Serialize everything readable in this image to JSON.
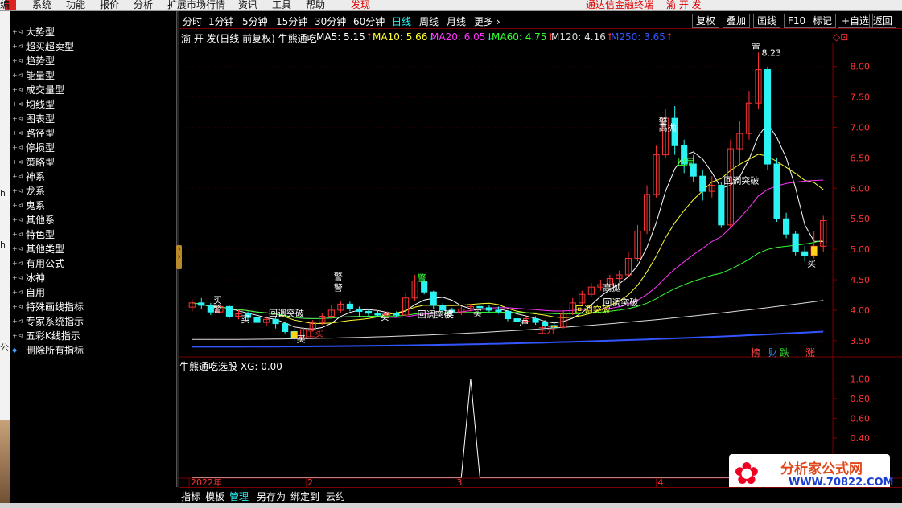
{
  "menubar": {
    "left_fragment": "编",
    "items": [
      "系统",
      "功能",
      "报价",
      "分析",
      "扩展市场行情",
      "资讯",
      "工具",
      "帮助"
    ],
    "find": "发现",
    "right_text": "通达信金融终端",
    "stock": "渝 开 发"
  },
  "left_edge": {
    "chars": [
      "h",
      "h",
      "公"
    ]
  },
  "indicator_panel": {
    "items": [
      "大势型",
      "超买超卖型",
      "趋势型",
      "能量型",
      "成交量型",
      "均线型",
      "图表型",
      "路径型",
      "停损型",
      "策略型",
      "神系",
      "龙系",
      "鬼系",
      "其他系",
      "特色型",
      "其他类型",
      "有用公式",
      "冰神",
      "自用",
      "特殊画线指标",
      "专家系统指示",
      "五彩K线指示",
      "删除所有指标"
    ]
  },
  "toolbar": {
    "periods": [
      "分时",
      "1分钟",
      "5分钟",
      "15分钟",
      "30分钟",
      "60分钟",
      "日线",
      "周线",
      "月线",
      "更多 ›"
    ],
    "active_period": "日线",
    "right_buttons": [
      "复权",
      "叠加",
      "画线",
      "F10",
      "标记",
      "+自选",
      "返回"
    ]
  },
  "chart_header": {
    "title": "渝 开 发(日线 前复权) 牛熊通吃",
    "ma": [
      {
        "label": "MA5: 5.15",
        "arrow": "↑",
        "color": "#ffffff"
      },
      {
        "label": "MA10: 5.66",
        "arrow": "↓",
        "color": "#ffff33"
      },
      {
        "label": "MA20: 6.05",
        "arrow": "↓",
        "color": "#ff33ff"
      },
      {
        "label": "MA60: 4.75",
        "arrow": "↑",
        "color": "#33ff33"
      },
      {
        "label": "M120: 4.16",
        "arrow": "↑",
        "color": "#dddddd"
      },
      {
        "label": "M250: 3.65",
        "arrow": "↑",
        "color": "#3355ff"
      }
    ],
    "corner_icons": "◇⊡"
  },
  "volume_header": {
    "title": "牛熊通吃选股",
    "label": "XG: 0.00"
  },
  "date_labels": [
    "2022年",
    "2",
    "3",
    "4"
  ],
  "signal_labels": [
    "警",
    "回调突破",
    "买",
    "买",
    "警",
    "买",
    "主买",
    "回调突破",
    "买",
    "买",
    "冲",
    "主升",
    "回调突破",
    "警",
    "高抛",
    "回调突破",
    "高抛",
    "警",
    "出局",
    "警",
    "回调突破",
    "买",
    "警",
    "买"
  ],
  "tags": [
    {
      "text": "榜",
      "color": "#ff4444"
    },
    {
      "text": "财",
      "color": "#3399ff"
    },
    {
      "text": "跌",
      "color": "#33cc33"
    },
    {
      "text": "涨",
      "color": "#ff4444"
    }
  ],
  "bottom_tabs": [
    "指标",
    "模板",
    "管理",
    "另存为",
    "绑定到",
    "云约"
  ],
  "active_bottom_tab": "管理",
  "watermark": {
    "logo_glyph": "✿",
    "title": "分析家公式网",
    "url": "WWW.70822.COM"
  },
  "colors": {
    "up": "#ff3333",
    "down": "#2cf3f3",
    "ma5": "#ffffff",
    "ma10": "#ffff33",
    "ma20": "#ff33ff",
    "ma60": "#33ff33",
    "ma120": "#dddddd",
    "ma250": "#3355ff",
    "grid": "#7a0000"
  },
  "chart_data": [
    {
      "type": "candlestick",
      "title": "渝 开 发(日线 前复权) 牛熊通吃",
      "x_labels": [
        "2022年",
        "2",
        "3",
        "4"
      ],
      "ylim": [
        3.3,
        8.3
      ],
      "y_ticks": [
        "8.00",
        "7.50",
        "7.00",
        "6.50",
        "6.00",
        "5.50",
        "5.00",
        "4.50",
        "4.00",
        "3.50"
      ],
      "annotations": [
        "8.23"
      ],
      "candles": [
        [
          4.05,
          4.12,
          4.18,
          3.98
        ],
        [
          4.12,
          4.08,
          4.2,
          4.02
        ],
        [
          4.08,
          3.97,
          4.12,
          3.92
        ],
        [
          3.97,
          4.06,
          4.1,
          3.93
        ],
        [
          4.06,
          3.9,
          4.08,
          3.86
        ],
        [
          3.9,
          3.94,
          4.0,
          3.85
        ],
        [
          3.94,
          3.88,
          3.98,
          3.82
        ],
        [
          3.88,
          3.8,
          3.92,
          3.76
        ],
        [
          3.8,
          3.85,
          3.9,
          3.75
        ],
        [
          3.85,
          3.78,
          3.88,
          3.7
        ],
        [
          3.78,
          3.65,
          3.8,
          3.62
        ],
        [
          3.65,
          3.55,
          3.7,
          3.5
        ],
        [
          3.55,
          3.68,
          3.72,
          3.52
        ],
        [
          3.68,
          3.8,
          3.84,
          3.65
        ],
        [
          3.8,
          3.9,
          3.95,
          3.76
        ],
        [
          3.9,
          4.0,
          4.08,
          3.86
        ],
        [
          4.0,
          4.1,
          4.15,
          3.95
        ],
        [
          4.1,
          4.02,
          4.14,
          3.98
        ],
        [
          4.02,
          3.98,
          4.06,
          3.9
        ],
        [
          3.98,
          3.95,
          4.02,
          3.9
        ],
        [
          3.95,
          3.92,
          4.0,
          3.88
        ],
        [
          3.92,
          3.94,
          3.98,
          3.88
        ],
        [
          3.94,
          3.92,
          3.98,
          3.88
        ],
        [
          3.92,
          4.2,
          4.28,
          3.9
        ],
        [
          4.2,
          4.48,
          4.58,
          4.15
        ],
        [
          4.48,
          4.3,
          4.52,
          4.26
        ],
        [
          4.3,
          4.08,
          4.32,
          4.02
        ],
        [
          4.08,
          4.0,
          4.12,
          3.96
        ],
        [
          4.0,
          3.96,
          4.04,
          3.92
        ],
        [
          3.96,
          4.02,
          4.06,
          3.92
        ],
        [
          4.02,
          4.06,
          4.1,
          3.98
        ],
        [
          4.06,
          4.04,
          4.1,
          4.0
        ],
        [
          4.04,
          4.0,
          4.08,
          3.96
        ],
        [
          4.0,
          3.98,
          4.06,
          3.94
        ],
        [
          3.98,
          3.86,
          4.0,
          3.82
        ],
        [
          3.86,
          3.82,
          3.92,
          3.78
        ],
        [
          3.82,
          3.86,
          3.9,
          3.78
        ],
        [
          3.86,
          3.8,
          3.9,
          3.76
        ],
        [
          3.8,
          3.75,
          3.84,
          3.7
        ],
        [
          3.75,
          3.72,
          3.8,
          3.68
        ],
        [
          3.72,
          3.95,
          4.0,
          3.7
        ],
        [
          3.95,
          4.12,
          4.2,
          3.92
        ],
        [
          4.12,
          4.26,
          4.32,
          4.08
        ],
        [
          4.26,
          4.38,
          4.45,
          4.22
        ],
        [
          4.38,
          4.42,
          4.5,
          4.32
        ],
        [
          4.42,
          4.52,
          4.58,
          4.38
        ],
        [
          4.52,
          4.58,
          4.65,
          4.45
        ],
        [
          4.58,
          4.85,
          4.95,
          4.55
        ],
        [
          4.85,
          5.3,
          5.4,
          4.8
        ],
        [
          5.3,
          5.9,
          6.05,
          5.25
        ],
        [
          5.9,
          6.55,
          6.7,
          5.85
        ],
        [
          6.55,
          7.15,
          7.3,
          6.5
        ],
        [
          7.15,
          6.7,
          7.35,
          6.55
        ],
        [
          6.7,
          6.4,
          6.8,
          6.25
        ],
        [
          6.4,
          6.2,
          6.55,
          6.1
        ],
        [
          6.2,
          5.95,
          6.3,
          5.8
        ],
        [
          5.95,
          6.05,
          6.2,
          5.85
        ],
        [
          6.05,
          5.4,
          6.1,
          5.35
        ],
        [
          5.4,
          6.65,
          6.8,
          5.35
        ],
        [
          6.65,
          6.9,
          7.1,
          6.4
        ],
        [
          6.9,
          7.4,
          7.6,
          6.8
        ],
        [
          7.4,
          7.95,
          8.23,
          7.3
        ],
        [
          7.95,
          6.4,
          8.0,
          6.3
        ],
        [
          6.4,
          5.5,
          6.5,
          5.45
        ],
        [
          5.5,
          5.25,
          5.6,
          5.18
        ],
        [
          5.25,
          4.96,
          5.3,
          4.9
        ],
        [
          4.96,
          4.9,
          5.05,
          4.8
        ],
        [
          4.9,
          5.05,
          5.3,
          4.85
        ],
        [
          5.05,
          5.47,
          5.55,
          4.95
        ]
      ],
      "series": [
        {
          "name": "MA5",
          "color": "#ffffff"
        },
        {
          "name": "MA10",
          "color": "#ffff33"
        },
        {
          "name": "MA20",
          "color": "#ff33ff"
        },
        {
          "name": "MA60",
          "color": "#33ff33"
        },
        {
          "name": "M120",
          "color": "#dddddd"
        },
        {
          "name": "M250",
          "color": "#3355ff"
        }
      ]
    },
    {
      "type": "line",
      "title": "牛熊通吃选股",
      "ylim": [
        0,
        1.1
      ],
      "y_ticks": [
        "1.00",
        "0.80",
        "0.60",
        "0.40",
        "0.20"
      ],
      "series": [
        {
          "name": "XG",
          "values": [
            0,
            0,
            0,
            0,
            0,
            0,
            0,
            0,
            0,
            0,
            0,
            0,
            0,
            0,
            0,
            0,
            0,
            0,
            0,
            0,
            0,
            0,
            0,
            0,
            0,
            0,
            0,
            0,
            0,
            0,
            1,
            0,
            0,
            0,
            0,
            0,
            0,
            0,
            0,
            0,
            0,
            0,
            0,
            0,
            0,
            0,
            0,
            0,
            0,
            0,
            0,
            0,
            0,
            0,
            0,
            0,
            0,
            0,
            0,
            0,
            0,
            0,
            0,
            0,
            0,
            0,
            0,
            0,
            0
          ]
        }
      ]
    }
  ]
}
